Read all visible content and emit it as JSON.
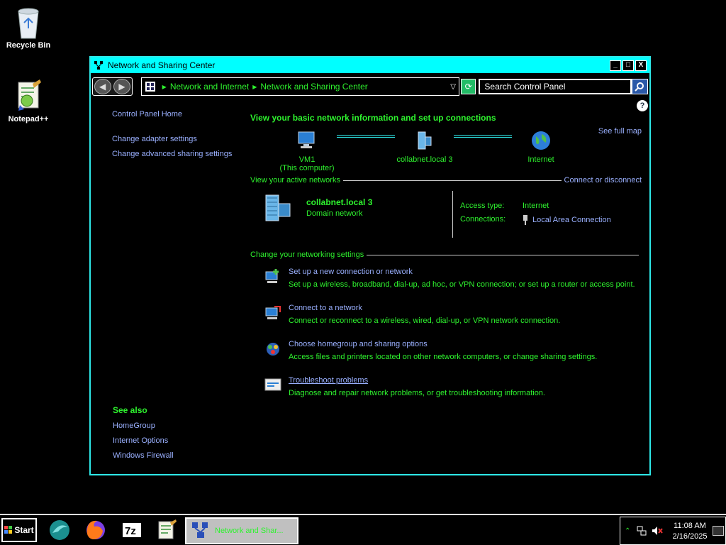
{
  "desktop": {
    "icons": [
      {
        "label": "Recycle Bin",
        "icon": "recycle-bin-icon"
      },
      {
        "label": "Notepad++",
        "icon": "notepad-plus-plus-icon"
      }
    ]
  },
  "window": {
    "title": "Network and Sharing Center",
    "controls": {
      "minimize": "_",
      "maximize": "□",
      "close": "X"
    },
    "address": {
      "crumbs": [
        "Network and Internet",
        "Network and Sharing Center"
      ]
    },
    "search": {
      "value": "Search Control Panel"
    }
  },
  "left_pane": {
    "links": [
      "Control Panel Home",
      "Change adapter settings",
      "Change advanced sharing settings"
    ],
    "see_also_heading": "See also",
    "see_also": [
      "HomeGroup",
      "Internet Options",
      "Windows Firewall"
    ]
  },
  "main": {
    "heading": "View your basic network information and set up connections",
    "see_full_map": "See full map",
    "map": {
      "computer_name": "VM1",
      "computer_sub": "(This computer)",
      "network": "collabnet.local  3",
      "internet": "Internet"
    },
    "active_section": "View your active networks",
    "connect_link": "Connect or disconnect",
    "active_network": {
      "name": "collabnet.local  3",
      "type": "Domain network",
      "access_type_label": "Access type:",
      "access_type_value": "Internet",
      "connections_label": "Connections:",
      "connections_value": "Local Area Connection"
    },
    "settings_section": "Change your networking settings",
    "tasks": [
      {
        "title": "Set up a new connection or network",
        "desc": "Set up a wireless, broadband, dial-up, ad hoc, or VPN connection; or set up a router or access point.",
        "icon": "new-connection-icon"
      },
      {
        "title": "Connect to a network",
        "desc": "Connect or reconnect to a wireless, wired, dial-up, or VPN network connection.",
        "icon": "connect-network-icon"
      },
      {
        "title": "Choose homegroup and sharing options",
        "desc": "Access files and printers located on other network computers, or change sharing settings.",
        "icon": "homegroup-icon"
      },
      {
        "title": "Troubleshoot problems",
        "desc": "Diagnose and repair network problems, or get troubleshooting information.",
        "icon": "troubleshoot-icon"
      }
    ]
  },
  "taskbar": {
    "start_label": "Start",
    "active_task": "Network and Shar...",
    "clock_time": "11:08 AM",
    "clock_date": "2/16/2025"
  }
}
